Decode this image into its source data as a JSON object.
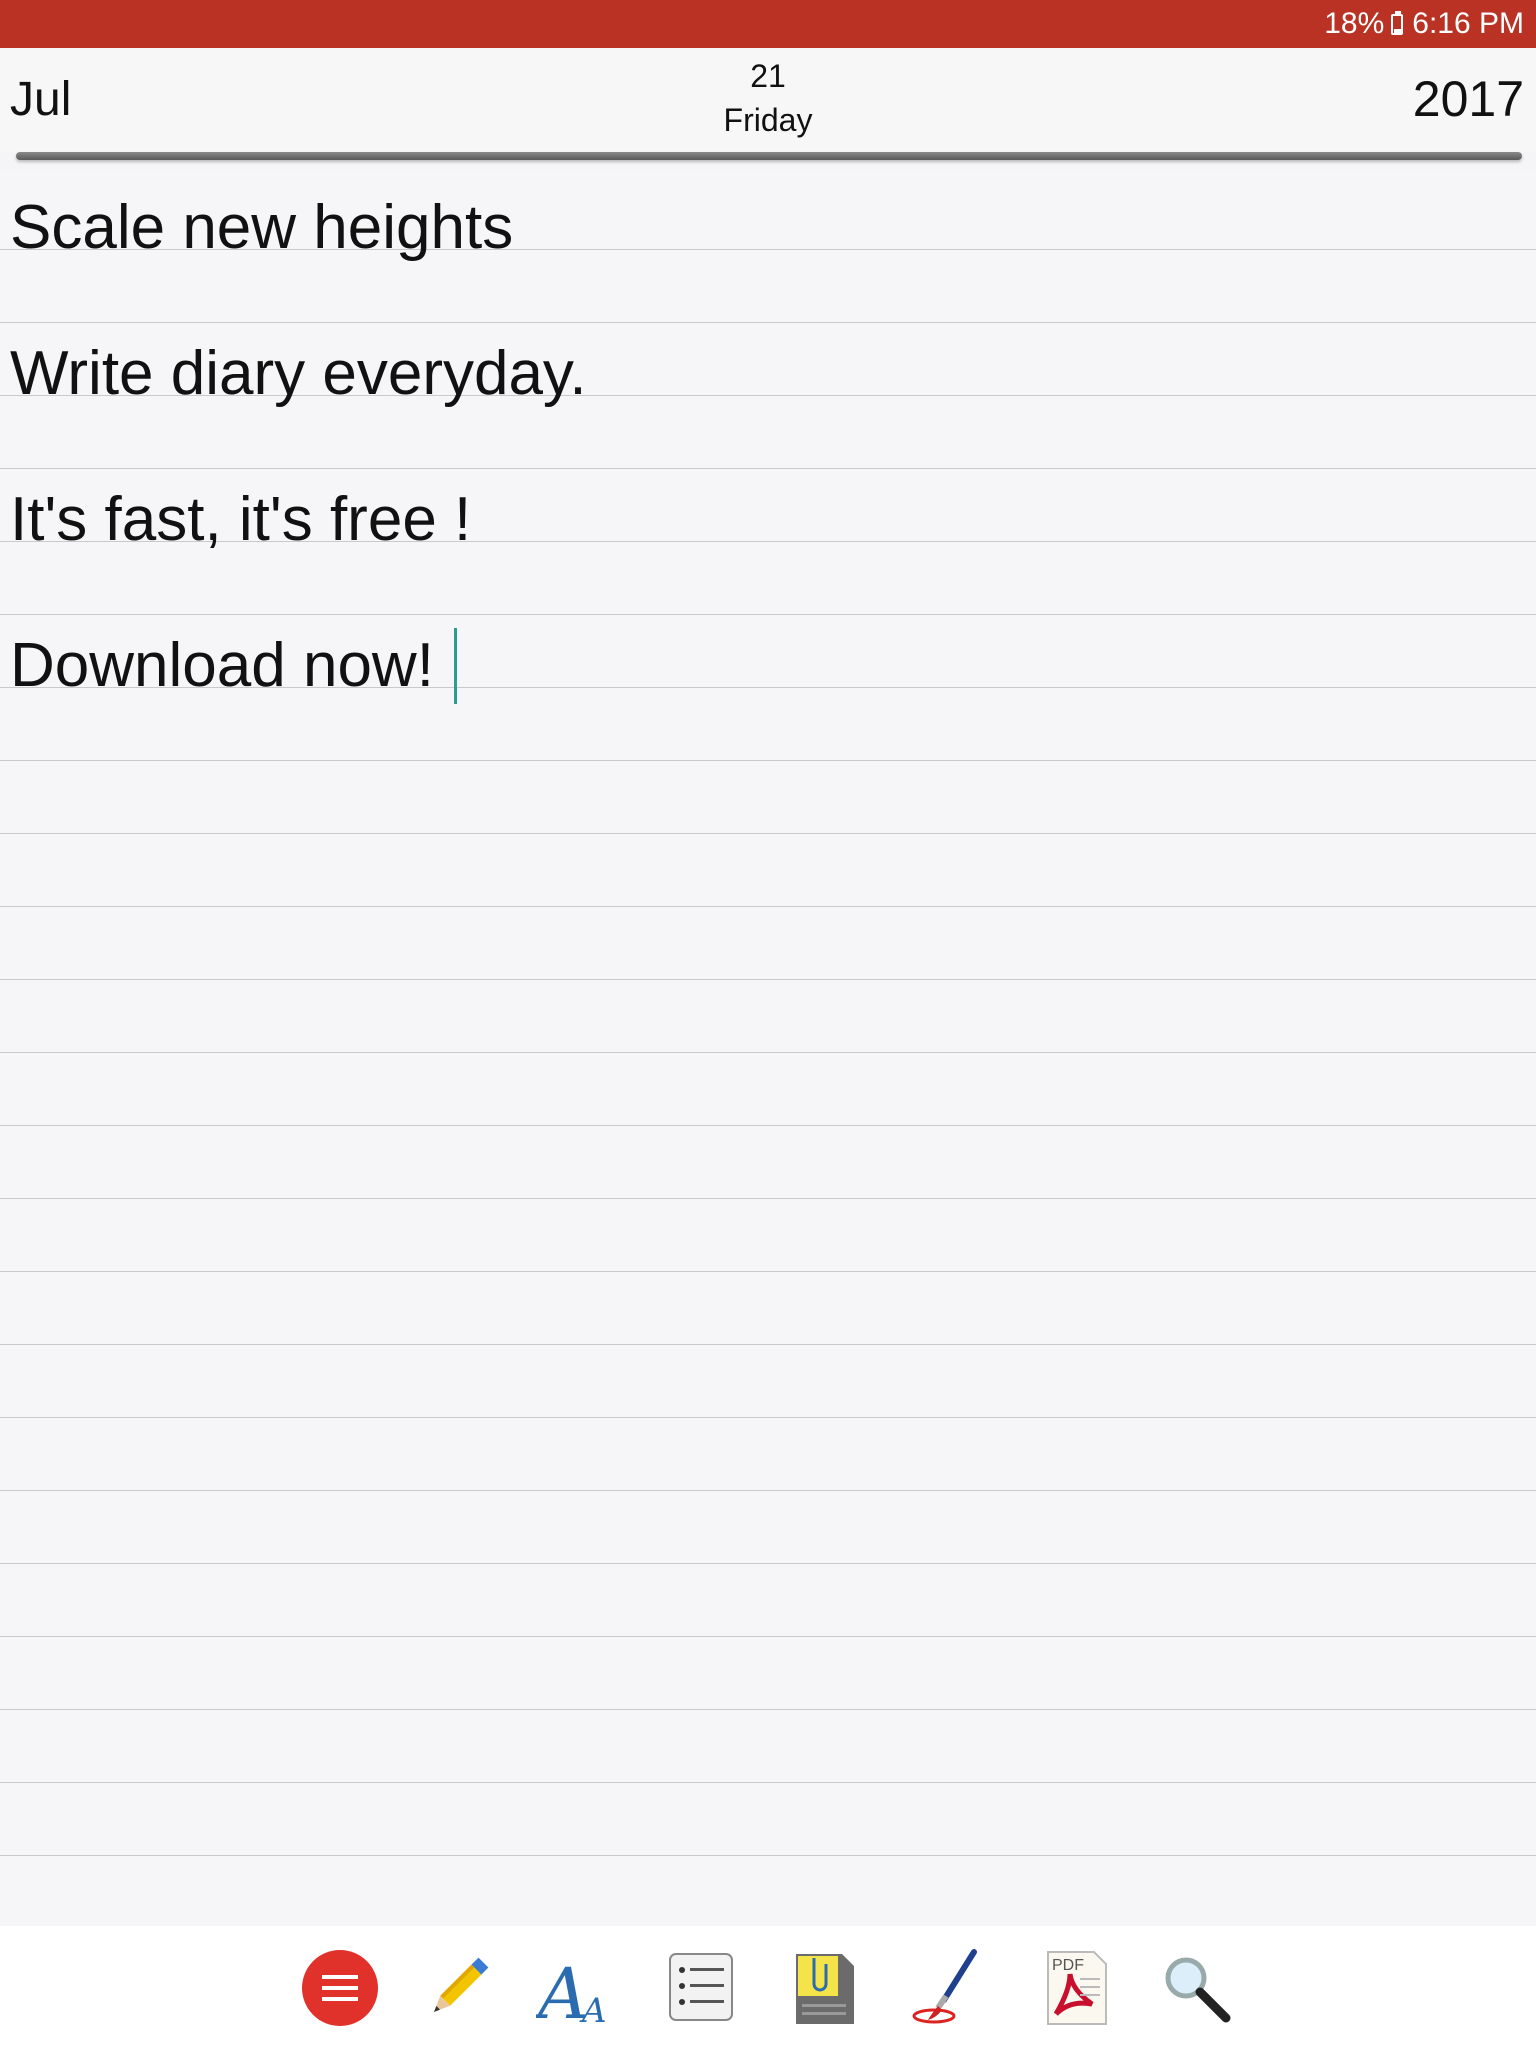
{
  "status_bar": {
    "battery": "18%",
    "time": "6:16 PM"
  },
  "header": {
    "month": "Jul",
    "day_number": "21",
    "day_name": "Friday",
    "year": "2017"
  },
  "entry": {
    "lines": [
      "Scale new heights",
      "Write diary everyday.",
      "It's fast, it's free !",
      "Download now!"
    ]
  },
  "toolbar": {
    "tools": [
      "menu-icon",
      "pencil-icon",
      "font-icon",
      "list-icon",
      "attachment-icon",
      "brush-icon",
      "pdf-icon",
      "search-icon"
    ]
  },
  "colors": {
    "status_bar": "#b93224",
    "menu_button": "#e0322b",
    "cursor": "#2a9d8f",
    "rule": "#c9c9cc"
  }
}
